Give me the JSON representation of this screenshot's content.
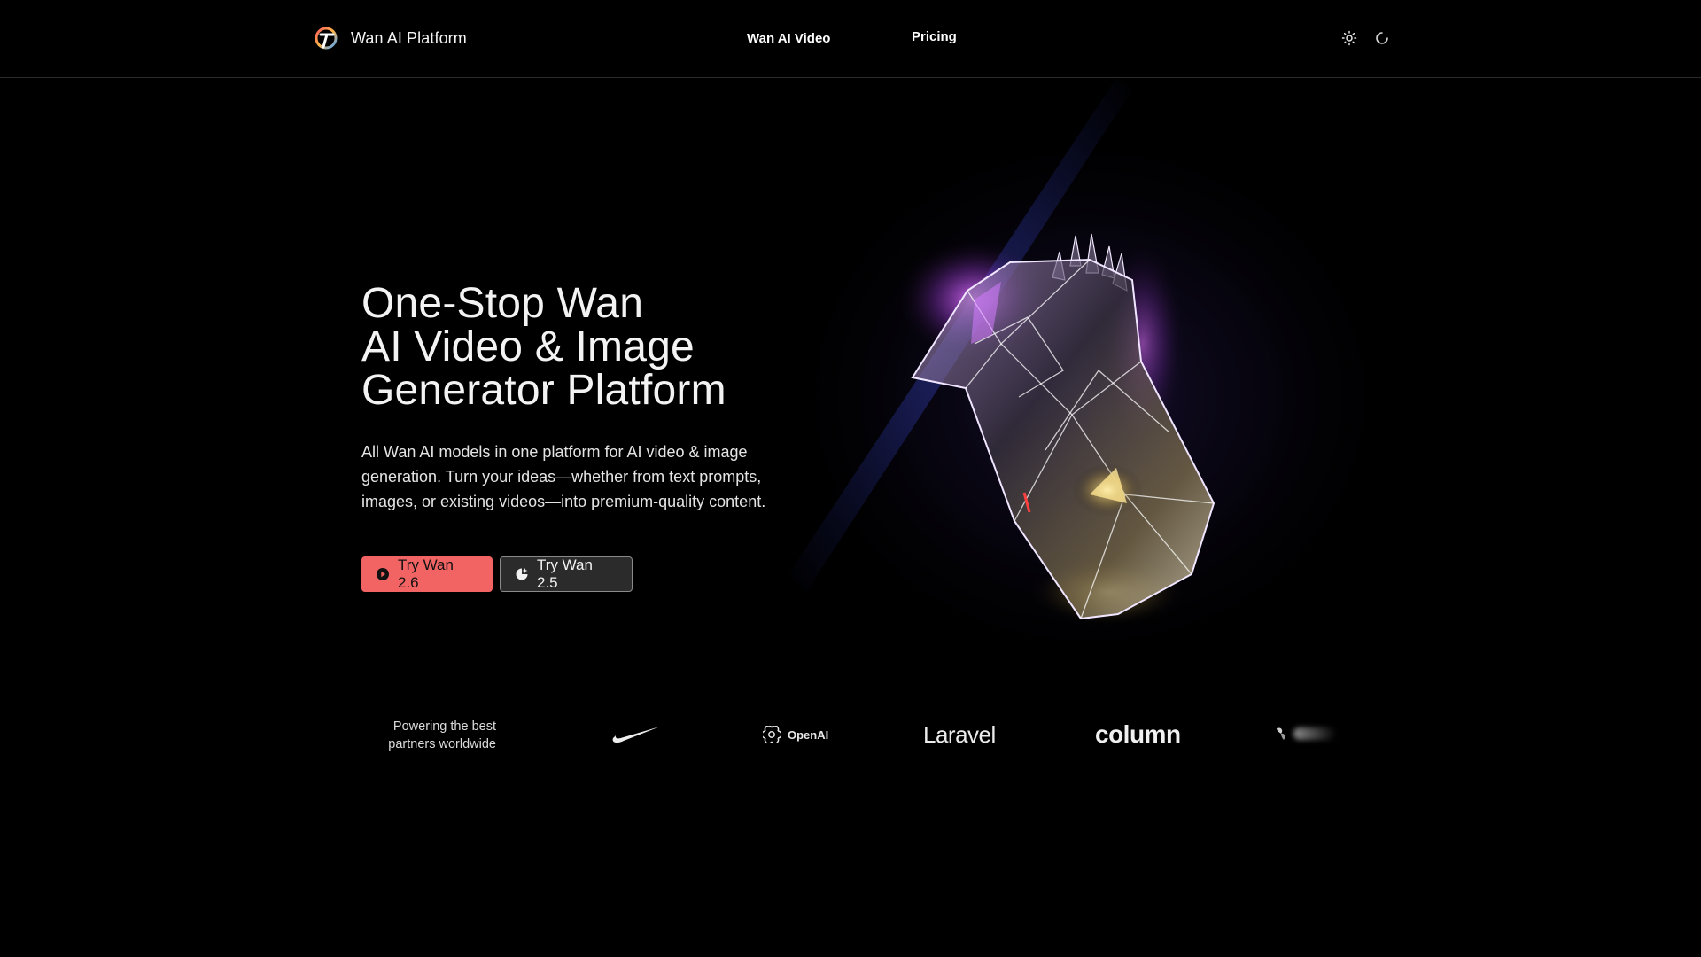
{
  "header": {
    "brand_name": "Wan AI Platform",
    "nav": {
      "video": "Wan AI Video",
      "pricing": "Pricing"
    }
  },
  "hero": {
    "title_lines": [
      "One-Stop Wan",
      "AI Video & Image",
      "Generator Platform"
    ],
    "description_lines": [
      "All Wan AI models in one platform for AI video & image",
      "generation. Turn your ideas—whether from text prompts,",
      "images, or existing videos—into premium-quality content."
    ],
    "buttons": {
      "primary": "Try Wan 2.6",
      "secondary": "Try Wan 2.5"
    }
  },
  "partners": {
    "caption_lines": [
      "Powering the best",
      "partners worldwide"
    ],
    "logos": [
      "Nike",
      "OpenAI",
      "Laravel",
      "column"
    ]
  },
  "colors": {
    "background": "#000000",
    "accent": "#f26464",
    "secondary_button": "#2b2b2b"
  },
  "icons": {
    "brand": "wan-logo-icon",
    "theme": "sun-icon",
    "loader": "loading-spinner-icon",
    "primary_button": "play-circle-icon",
    "secondary_button": "sparkle-icon"
  }
}
